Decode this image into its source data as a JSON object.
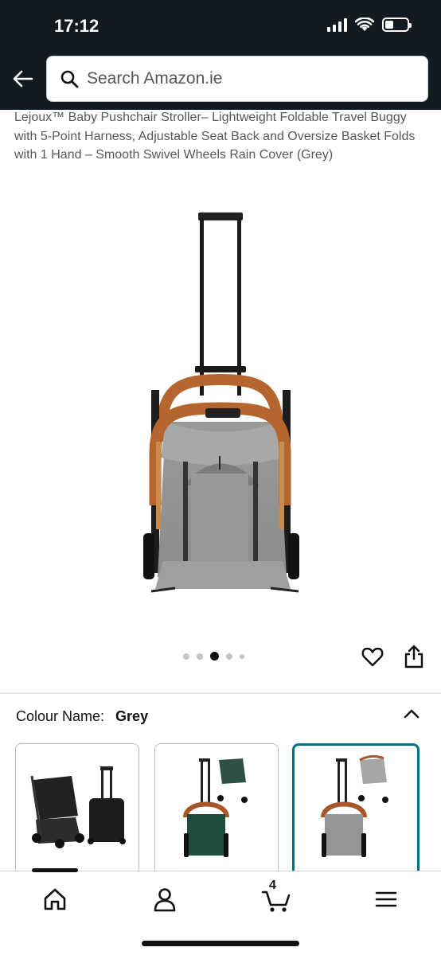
{
  "status_bar": {
    "time": "17:12"
  },
  "header": {
    "search_placeholder": "Search Amazon.ie",
    "back_icon": "arrow-left-icon",
    "search_icon": "magnifier-icon"
  },
  "product": {
    "title": "Lejoux™ Baby Pushchair Stroller– Lightweight Foldable Travel Buggy with 5-Point Harness, Adjustable Seat Back and Oversize Basket Folds with 1 Hand – Smooth Swivel Wheels Rain Cover (Grey)",
    "image_count": 5,
    "active_image_index": 2
  },
  "variation": {
    "label": "Colour Name:",
    "value": "Grey",
    "swatches": [
      {
        "color": "Black",
        "selected": false
      },
      {
        "color": "Green",
        "selected": false
      },
      {
        "color": "Grey",
        "selected": true
      }
    ]
  },
  "bottom_nav": {
    "items": [
      "home-icon",
      "account-icon",
      "cart-icon",
      "menu-icon"
    ],
    "cart_count": "4"
  },
  "colors": {
    "header_bg": "#131a22",
    "selected_border": "#007185",
    "frame_tan": "#b5662f"
  }
}
